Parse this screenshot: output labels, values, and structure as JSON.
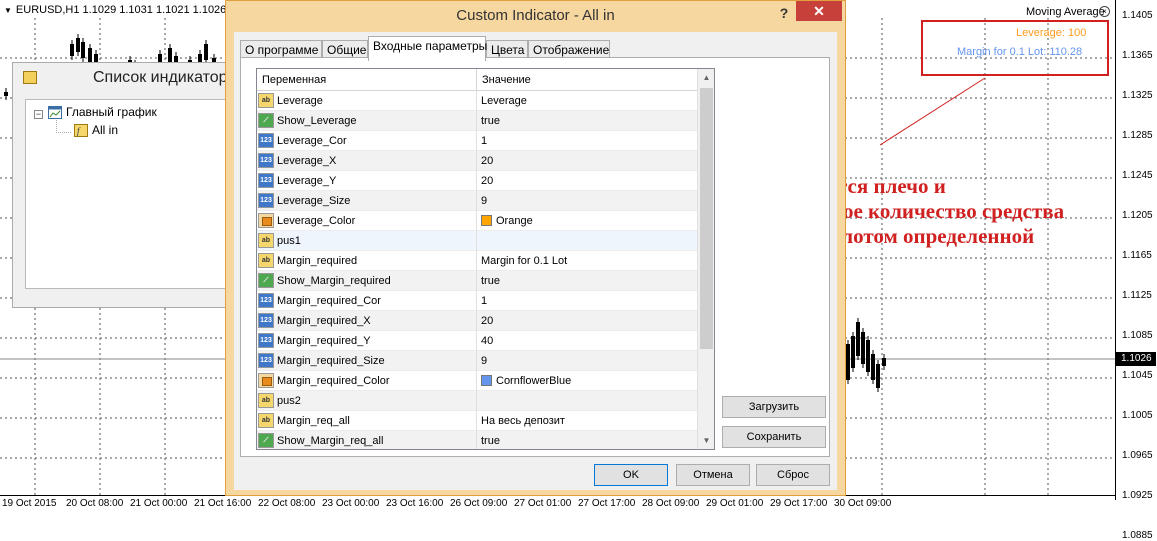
{
  "chart": {
    "header": "EURUSD,H1  1.1029 1.1031 1.1021 1.1026",
    "ma_label": "Moving Average",
    "prices": [
      "1.1405",
      "1.1365",
      "1.1325",
      "1.1285",
      "1.1245",
      "1.1205",
      "1.1165",
      "1.1125",
      "1.1085",
      "1.1045",
      "1.1026",
      "1.1005",
      "1.0965",
      "1.0925",
      "1.0885"
    ],
    "current_price": "1.1026",
    "times": [
      "19 Oct 2015",
      "20 Oct 08:00",
      "21 Oct 00:00",
      "21 Oct 16:00",
      "22 Oct 08:00",
      "23 Oct 00:00",
      "23 Oct 16:00",
      "26 Oct 09:00",
      "27 Oct 01:00",
      "27 Oct 17:00",
      "28 Oct 09:00",
      "29 Oct 01:00",
      "29 Oct 17:00",
      "30 Oct 09:00"
    ],
    "overlay_leverage": "Leverage: 100",
    "overlay_margin": "Margin for 0.1 Lot: 110.28",
    "annotation": "Указывается плечо и необходимое количество средства для входа лотом определенной величины",
    "colors": {
      "annotation": "#d02020",
      "leverage": "#ff9b1f",
      "margin": "#6495ed",
      "candles": "#000000"
    }
  },
  "indicator_list": {
    "title": "Список индикаторов",
    "tree": {
      "root": "Главный график",
      "child": "All in"
    }
  },
  "dialog": {
    "title": "Custom Indicator - All in",
    "help": "?",
    "close": "✕",
    "tabs": [
      "О программе",
      "Общие",
      "Входные параметры",
      "Цвета",
      "Отображение"
    ],
    "active_tab": 2,
    "columns": {
      "variable": "Переменная",
      "value": "Значение"
    },
    "rows": [
      {
        "type": "ab",
        "name": "Leverage",
        "value": "Leverage"
      },
      {
        "type": "bool",
        "name": "Show_Leverage",
        "value": "true"
      },
      {
        "type": "num",
        "name": "Leverage_Cor",
        "value": "1"
      },
      {
        "type": "num",
        "name": "Leverage_X",
        "value": "20"
      },
      {
        "type": "num",
        "name": "Leverage_Y",
        "value": "20"
      },
      {
        "type": "num",
        "name": "Leverage_Size",
        "value": "9"
      },
      {
        "type": "col",
        "name": "Leverage_Color",
        "value": "Orange",
        "swatch": "#ffa500"
      },
      {
        "type": "ab",
        "name": "pus1",
        "value": ""
      },
      {
        "type": "ab",
        "name": "Margin_required",
        "value": "Margin for 0.1 Lot"
      },
      {
        "type": "bool",
        "name": "Show_Margin_required",
        "value": "true"
      },
      {
        "type": "num",
        "name": "Margin_required_Cor",
        "value": "1"
      },
      {
        "type": "num",
        "name": "Margin_required_X",
        "value": "20"
      },
      {
        "type": "num",
        "name": "Margin_required_Y",
        "value": "40"
      },
      {
        "type": "num",
        "name": "Margin_required_Size",
        "value": "9"
      },
      {
        "type": "col",
        "name": "Margin_required_Color",
        "value": "CornflowerBlue",
        "swatch": "#6495ed"
      },
      {
        "type": "ab",
        "name": "pus2",
        "value": ""
      },
      {
        "type": "ab",
        "name": "Margin_req_all",
        "value": "На весь депозит"
      },
      {
        "type": "bool",
        "name": "Show_Margin_req_all",
        "value": "true"
      }
    ],
    "selected_row": 7,
    "buttons": {
      "load": "Загрузить",
      "save": "Сохранить",
      "ok": "OK",
      "cancel": "Отмена",
      "reset": "Сброс"
    }
  }
}
